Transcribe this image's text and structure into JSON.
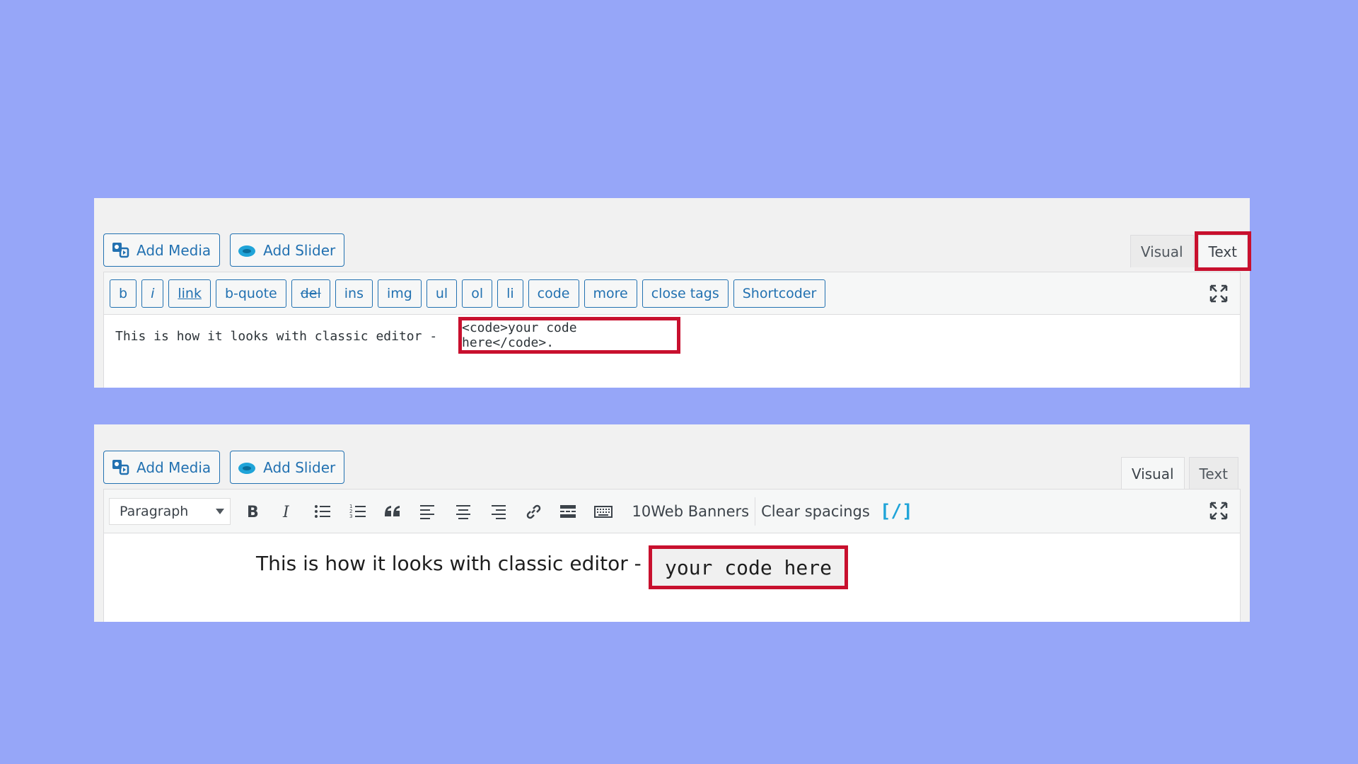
{
  "colors": {
    "background": "#96a6f8",
    "accent": "#2271b1",
    "highlight": "#c8102e"
  },
  "text_editor": {
    "add_media_label": "Add Media",
    "add_slider_label": "Add Slider",
    "tabs": {
      "visual": "Visual",
      "text": "Text"
    },
    "quicktags": [
      "b",
      "i",
      "link",
      "b-quote",
      "del",
      "ins",
      "img",
      "ul",
      "ol",
      "li",
      "code",
      "more",
      "close tags",
      "Shortcoder"
    ],
    "content_text": "This is how it looks with classic editor - ",
    "content_code": "<code>your code here</code>."
  },
  "visual_editor": {
    "add_media_label": "Add Media",
    "add_slider_label": "Add Slider",
    "tabs": {
      "visual": "Visual",
      "text": "Text"
    },
    "format_select": "Paragraph",
    "toolbar_text": {
      "banners": "10Web Banners",
      "clear_spacings": "Clear spacings",
      "shortcoder": "[/]"
    },
    "content_text": "This is how it looks with classic editor -",
    "content_code": "your code here"
  }
}
